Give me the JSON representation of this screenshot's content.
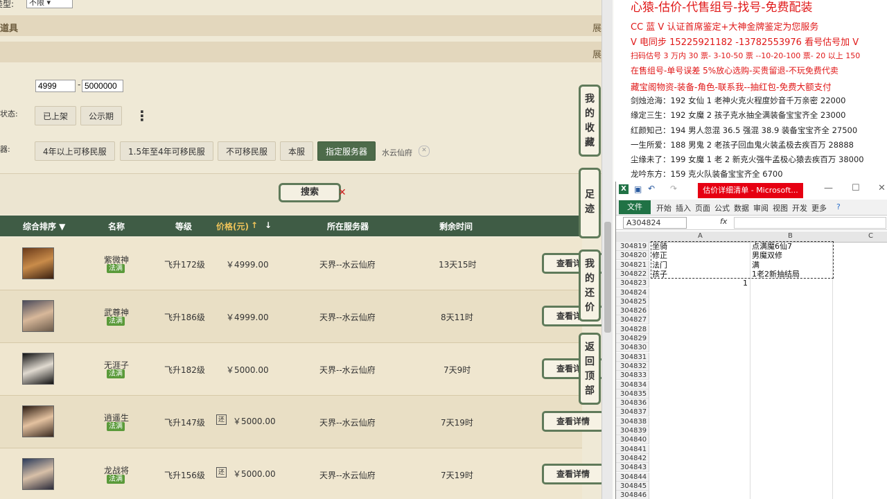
{
  "left": {
    "type_label": "类型:",
    "type_select": "不限",
    "strip1_label": "道具",
    "strip1_right": "展",
    "strip2_label": "",
    "strip2_right": "展",
    "price_label": "",
    "price_min": "4999",
    "price_max": "5000000",
    "price_dash": "-",
    "status_label": "状态:",
    "status_buttons": [
      "已上架",
      "公示期"
    ],
    "more_icon": "⋮",
    "server_label": "器:",
    "server_buttons": [
      "4年以上可移民服",
      "1.5年至4年可移民服",
      "不可移民服",
      "本服",
      "指定服务器"
    ],
    "selected_server": "水云仙府",
    "search_label": "搜索",
    "table_headers": {
      "sort": "综合排序 ▼",
      "name": "名称",
      "level": "等级",
      "price": "价格(元)",
      "server": "所在服务器",
      "time": "剩余时间"
    },
    "rows": [
      {
        "name": "紫微神",
        "tag": "法满",
        "level": "飞升172级",
        "price": "￥4999.00",
        "huan": "",
        "server": "天界--水云仙府",
        "time": "13天15时",
        "detail": "查看详"
      },
      {
        "name": "武尊神",
        "tag": "法满",
        "level": "飞升186级",
        "price": "￥4999.00",
        "huan": "",
        "server": "天界--水云仙府",
        "time": "8天11时",
        "detail": "查看详"
      },
      {
        "name": "无涯子",
        "tag": "法满",
        "level": "飞升182级",
        "price": "￥5000.00",
        "huan": "",
        "server": "天界--水云仙府",
        "time": "7天9时",
        "detail": "查看详"
      },
      {
        "name": "逍遥生",
        "tag": "法满",
        "level": "飞升147级",
        "price": "￥5000.00",
        "huan": "还",
        "server": "天界--水云仙府",
        "time": "7天19时",
        "detail": "查看详情"
      },
      {
        "name": "龙战将",
        "tag": "法满",
        "level": "飞升156级",
        "price": "￥5000.00",
        "huan": "还",
        "server": "天界--水云仙府",
        "time": "7天19时",
        "detail": "查看详情"
      }
    ],
    "side_buttons": [
      "我的收藏",
      "足迹",
      "我的还价",
      "返回顶部"
    ]
  },
  "ad": {
    "lines": [
      {
        "text": "心猿-估价-代售组号-找号-免费配装",
        "color": "red"
      },
      {
        "text": "CC 蓝 V 认证首席鉴定+大神金牌鉴定为您服务",
        "color": "red"
      },
      {
        "text": "V 电同步 15225921182 -13782553976 看号估号加 V",
        "color": "red"
      },
      {
        "text": "扫码估号 3 万内 30 票- 3-10-50 票 --10-20-100 票- 20 以上 150",
        "color": "red"
      },
      {
        "text": "在售组号-单号误差 5%放心选购-买贵留退-不玩免费代卖",
        "color": "red"
      },
      {
        "text": "藏宝阁物资-装备-角色-联系我--抽红包-免费大额支付",
        "color": "red"
      },
      {
        "text": "剑烛沧海：192 女仙 1 老神火克火程度妙音千万亲密 22000",
        "color": "black"
      },
      {
        "text": "缘定三生：192 女魔 2 孩子克水抽全满装备宝宝齐全 23000",
        "color": "black"
      },
      {
        "text": "红颜知己：194 男人忽混 36.5 强混 38.9 装备宝宝齐全 27500",
        "color": "black"
      },
      {
        "text": "一生所爱：188 男鬼 2 老孩子回血鬼火装孟极去疾百万 28888",
        "color": "black"
      },
      {
        "text": "尘缘未了：199 女魔 1 老 2 新克火强牛孟极心猿去疾百万 38000",
        "color": "black"
      },
      {
        "text": "龙吟东方：159 克火队装备宝宝齐全 6700",
        "color": "black"
      }
    ]
  },
  "excel": {
    "title": "估价详细清单 - Microsoft...",
    "tabs": [
      "文件",
      "开始",
      "插入",
      "页面",
      "公式",
      "数据",
      "审阅",
      "视图",
      "开发",
      "更多"
    ],
    "namebox": "A304824",
    "fx": "fx",
    "col_headers": [
      "A",
      "B",
      "C"
    ],
    "rows": [
      {
        "num": "304819",
        "a": "坐骑",
        "b": "点满魔6仙7"
      },
      {
        "num": "304820",
        "a": "修正",
        "b": "男魔双修"
      },
      {
        "num": "304821",
        "a": "法门",
        "b": "满"
      },
      {
        "num": "304822",
        "a": "孩子",
        "b": "1老2新抽结局"
      },
      {
        "num": "304823",
        "a": "1",
        "b": ""
      },
      {
        "num": "304824",
        "a": "",
        "b": ""
      },
      {
        "num": "304825",
        "a": "",
        "b": ""
      },
      {
        "num": "304826",
        "a": "",
        "b": ""
      },
      {
        "num": "304827",
        "a": "",
        "b": ""
      },
      {
        "num": "304828",
        "a": "",
        "b": ""
      },
      {
        "num": "304829",
        "a": "",
        "b": ""
      },
      {
        "num": "304830",
        "a": "",
        "b": ""
      },
      {
        "num": "304831",
        "a": "",
        "b": ""
      },
      {
        "num": "304832",
        "a": "",
        "b": ""
      },
      {
        "num": "304833",
        "a": "",
        "b": ""
      },
      {
        "num": "304834",
        "a": "",
        "b": ""
      },
      {
        "num": "304835",
        "a": "",
        "b": ""
      },
      {
        "num": "304836",
        "a": "",
        "b": ""
      },
      {
        "num": "304837",
        "a": "",
        "b": ""
      },
      {
        "num": "304838",
        "a": "",
        "b": ""
      },
      {
        "num": "304839",
        "a": "",
        "b": ""
      },
      {
        "num": "304840",
        "a": "",
        "b": ""
      },
      {
        "num": "304841",
        "a": "",
        "b": ""
      },
      {
        "num": "304842",
        "a": "",
        "b": ""
      },
      {
        "num": "304843",
        "a": "",
        "b": ""
      },
      {
        "num": "304844",
        "a": "",
        "b": ""
      },
      {
        "num": "304845",
        "a": "",
        "b": ""
      },
      {
        "num": "304846",
        "a": "",
        "b": ""
      }
    ]
  },
  "colors": {
    "header_green": "#3f5c45",
    "active_green": "#4d6b4a",
    "ad_red": "#e01818",
    "excel_green": "#207245"
  }
}
